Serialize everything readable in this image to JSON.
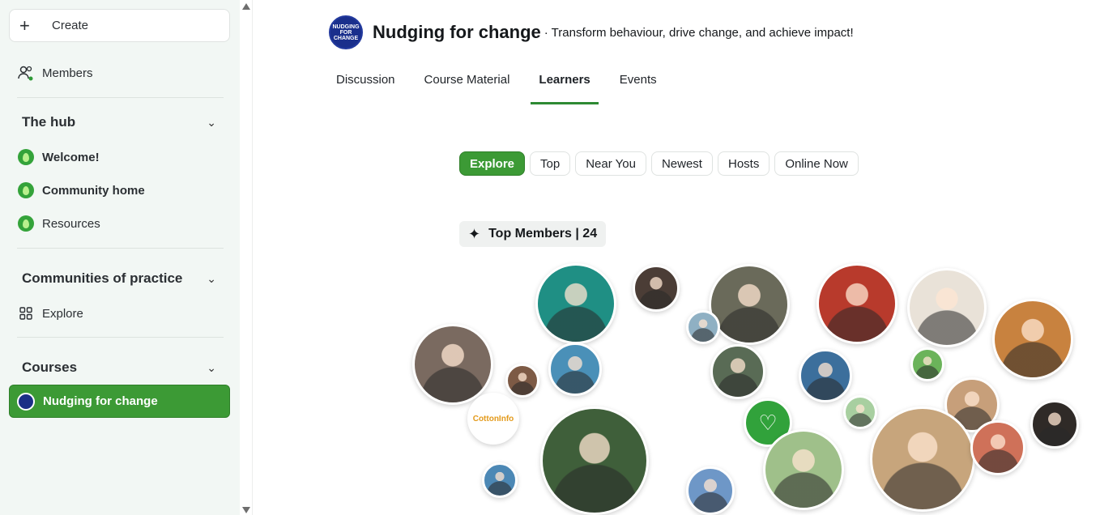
{
  "sidebar": {
    "create_label": "Create",
    "members_label": "Members",
    "hub": {
      "title": "The hub",
      "items": [
        {
          "label": "Welcome!"
        },
        {
          "label": "Community home"
        },
        {
          "label": "Resources"
        }
      ]
    },
    "communities": {
      "title": "Communities of practice",
      "explore_label": "Explore"
    },
    "courses": {
      "title": "Courses",
      "active_course": "Nudging for change"
    }
  },
  "header": {
    "logo_text": "NUDGING FOR CHANGE",
    "title": "Nudging for change",
    "tagline": "· Transform behaviour, drive change, and achieve impact!"
  },
  "tabs": [
    {
      "label": "Discussion"
    },
    {
      "label": "Course Material"
    },
    {
      "label": "Learners",
      "active": true
    },
    {
      "label": "Events"
    }
  ],
  "filters": [
    {
      "label": "Explore",
      "active": true
    },
    {
      "label": "Top"
    },
    {
      "label": "Near You"
    },
    {
      "label": "Newest"
    },
    {
      "label": "Hosts"
    },
    {
      "label": "Online Now"
    }
  ],
  "top_members": {
    "label": "Top Members | 24"
  },
  "bubbles": [
    {
      "name": "member-avatar",
      "color": "#1f8f84"
    },
    {
      "name": "member-avatar",
      "color": "#4b3d36"
    },
    {
      "name": "member-avatar",
      "color": "#6a6a5a"
    },
    {
      "name": "member-avatar",
      "color": "#b83a2c"
    },
    {
      "name": "member-avatar",
      "color": "#e9e2d8"
    },
    {
      "name": "member-avatar",
      "color": "#c8823f"
    },
    {
      "name": "member-avatar",
      "color": "#7a6a60"
    },
    {
      "name": "member-avatar",
      "color": "#8fb0c3"
    },
    {
      "name": "member-avatar",
      "color": "#4a90b8"
    },
    {
      "name": "member-avatar",
      "color": "#596b55"
    },
    {
      "name": "member-avatar",
      "color": "#7d5a45"
    },
    {
      "name": "member-avatar",
      "color": "#3c6f9c"
    },
    {
      "name": "member-avatar",
      "color": "#6bb35a"
    },
    {
      "name": "member-avatar",
      "color": "#a8cfa0"
    },
    {
      "name": "member-avatar",
      "color": "#c79f7a"
    },
    {
      "name": "member-avatar",
      "color": "#3f5f3a"
    },
    {
      "name": "member-avatar",
      "color": "#2f2a27"
    },
    {
      "name": "member-avatar",
      "color": "#31a23b"
    },
    {
      "name": "member-avatar",
      "color": "#d9d2c4"
    },
    {
      "name": "member-avatar",
      "color": "#9fc08a"
    },
    {
      "name": "member-avatar",
      "color": "#c7a57c"
    },
    {
      "name": "member-avatar",
      "color": "#cf7159"
    },
    {
      "name": "member-avatar",
      "color": "#4c88b5"
    },
    {
      "name": "member-avatar",
      "color": "#6e97c7"
    }
  ],
  "cotton_logo_text": "CottonInfo"
}
